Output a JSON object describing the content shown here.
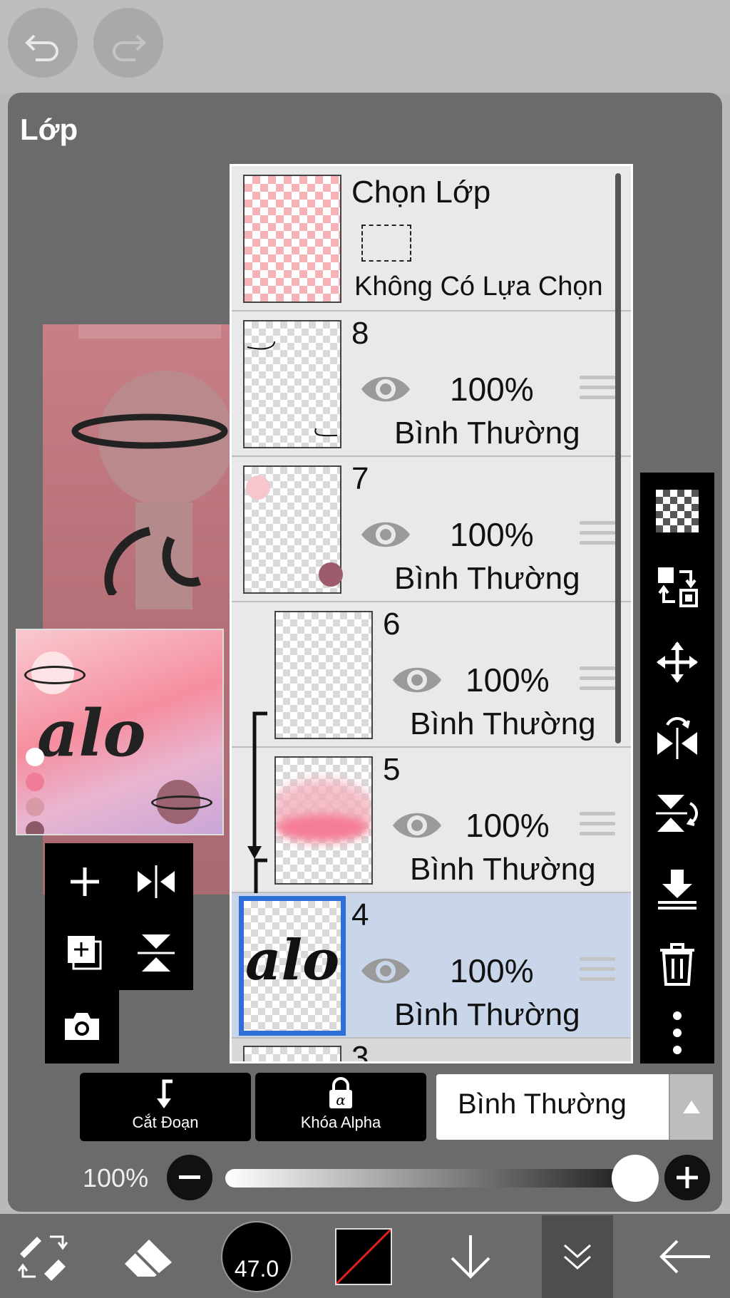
{
  "panel": {
    "title": "Lớp"
  },
  "selection_layer": {
    "title": "Chọn Lớp",
    "status": "Không Có Lựa Chọn"
  },
  "layers": [
    {
      "num": "8",
      "opacity": "100%",
      "blend": "Bình Thường"
    },
    {
      "num": "7",
      "opacity": "100%",
      "blend": "Bình Thường"
    },
    {
      "num": "6",
      "opacity": "100%",
      "blend": "Bình Thường"
    },
    {
      "num": "5",
      "opacity": "100%",
      "blend": "Bình Thường"
    },
    {
      "num": "4",
      "opacity": "100%",
      "blend": "Bình Thường",
      "selected": true
    },
    {
      "num": "3"
    }
  ],
  "layer4_thumb_text": "alo",
  "buttons": {
    "clip": "Cắt Đoạn",
    "alpha_lock": "Khóa Alpha"
  },
  "blend_mode": {
    "value": "Bình Thường"
  },
  "opacity": {
    "label": "100%",
    "value": 1.0
  },
  "brush": {
    "size": "47.0"
  },
  "colors": {
    "accent": "#2f6fd8",
    "selected_row": "#c9d6ea"
  },
  "icons": [
    "undo-icon",
    "redo-icon",
    "eye-icon",
    "checkerboard-icon",
    "swap-icon",
    "move-icon",
    "flip-horizontal-icon",
    "flip-vertical-icon",
    "merge-down-icon",
    "trash-icon",
    "more-icon",
    "add-layer-icon",
    "duplicate-layer-icon",
    "camera-icon",
    "eraser-icon",
    "arrow-down-icon",
    "double-chevron-icon",
    "back-arrow-icon"
  ]
}
